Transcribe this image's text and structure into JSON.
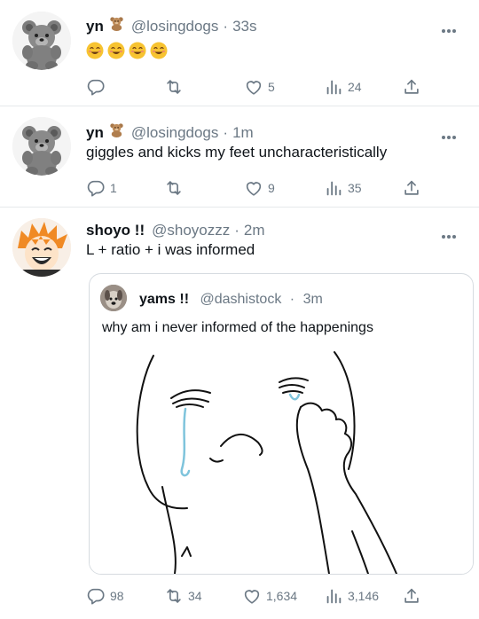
{
  "tweets": [
    {
      "name": "yn",
      "handle": "@losingdogs",
      "time": "33s",
      "separator": "·",
      "text": "",
      "emojis": [
        "smiling-face",
        "smiling-face",
        "smiling-face",
        "smiling-face"
      ],
      "replies": "",
      "retweets": "",
      "likes": "5",
      "views": "24"
    },
    {
      "name": "yn",
      "handle": "@losingdogs",
      "time": "1m",
      "separator": "·",
      "text": "giggles and kicks my feet uncharacteristically",
      "replies": "1",
      "retweets": "",
      "likes": "9",
      "views": "35"
    },
    {
      "name": "shoyo !!",
      "handle": "@shoyozzz",
      "time": "2m",
      "separator": "·",
      "text": "L + ratio + i was informed",
      "replies": "98",
      "retweets": "34",
      "likes": "1,634",
      "views": "3,146",
      "quote": {
        "name": "yams !!",
        "handle": "@dashistock",
        "time": "3m",
        "separator": "·",
        "text": "why am i never informed of the happenings",
        "media": "crying-drawing"
      }
    }
  ],
  "colors": {
    "text": "#0f1419",
    "secondary": "#6b7884",
    "border": "#e6e9eb",
    "tear": "#7fc4dc"
  },
  "icons": [
    "reply-icon",
    "retweet-icon",
    "like-icon",
    "views-icon",
    "share-icon",
    "more-icon",
    "teddy-bear-icon"
  ]
}
